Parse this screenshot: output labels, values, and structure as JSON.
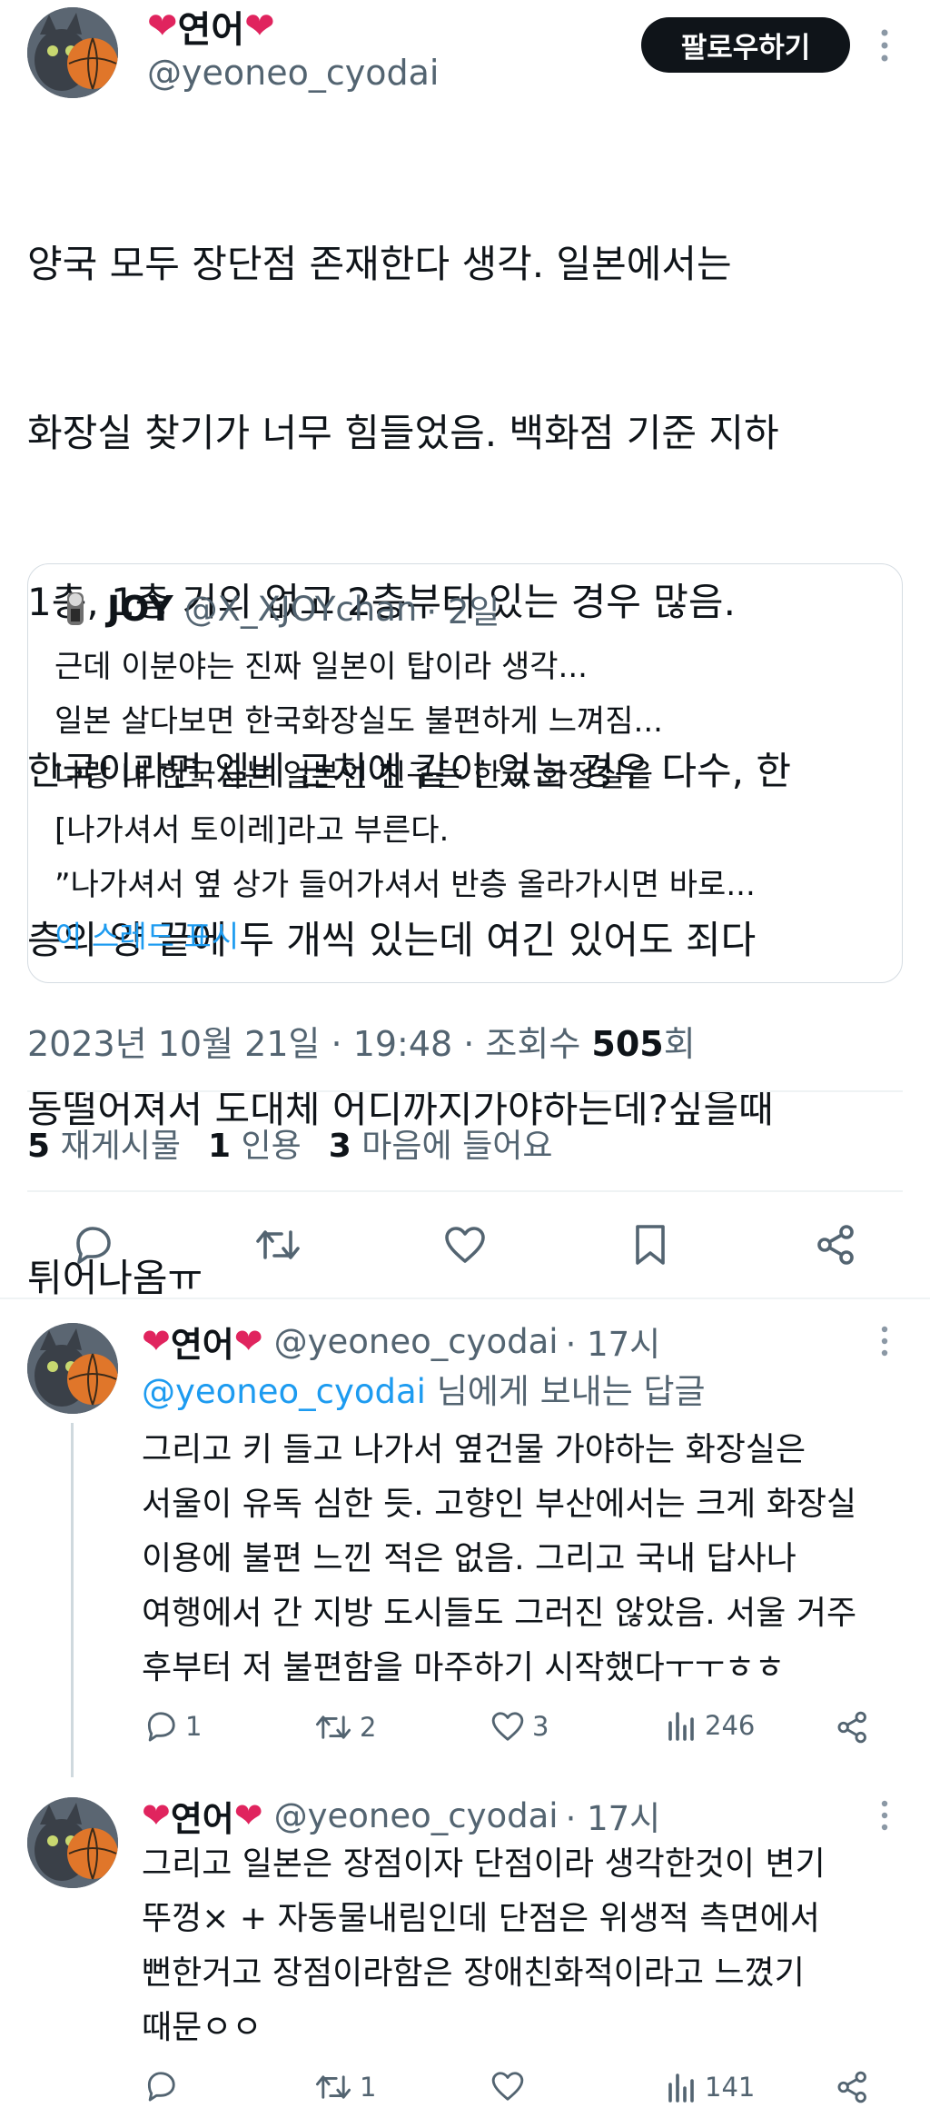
{
  "tweet": {
    "name": "연어",
    "handle": "@yeoneo_cyodai",
    "follow_label": "팔로우하기",
    "text_lines": [
      "양국 모두 장단점 존재한다 생각. 일본에서는",
      "화장실 찾기가 너무 힘들었음. 백화점 기준 지하",
      "1층, 1층 거의 없고 2층부터 있는 경우 많음.",
      "한국이라면 엘베 근처에 같이 있는 경우 다수, 한",
      "층의 양 끝에 두 개씩 있는데 여긴 있어도 죄다",
      "동떨어져서 도대체 어디까지가야하는데?싶을때",
      "튀어나옴ㅠ"
    ],
    "quote": {
      "name": "JOY",
      "handle": "@X_XJOYchan",
      "time": "· 2일",
      "lines": [
        "근데 이분야는 진짜 일본이 탑이라 생각...",
        "일본 살다보면 한국화장실도 불편하게 느껴짐...",
        "나랑 내 한국사는 일본인 친구는 한국 화장실을",
        "[나가셔서 토이레]라고 부른다.",
        "”나가셔서 옆 상가 들어가셔서 반층 올라가시면 바로..."
      ],
      "show_thread": "이 스레드 표시"
    },
    "meta": {
      "datetime": "2023년 10월 21일 · 19:48 · 조회수 ",
      "views": "505",
      "views_suffix": "회"
    },
    "stats": {
      "retweets_count": "5",
      "retweets_label": "재게시물",
      "quotes_count": "1",
      "quotes_label": "인용",
      "likes_count": "3",
      "likes_label": "마음에 들어요"
    }
  },
  "replies": [
    {
      "name": "연어",
      "handle": "@yeoneo_cyodai",
      "time": "· 17시",
      "reply_to_handle": "@yeoneo_cyodai",
      "reply_to_suffix": " 님에게 보내는 답글",
      "lines": [
        "그리고 키 들고 나가서 옆건물 가야하는 화장실은",
        "서울이 유독 심한 듯. 고향인 부산에서는 크게 화장실",
        "이용에 불편 느낀 적은 없음. 그리고 국내 답사나",
        "여행에서 간 지방 도시들도 그러진 않았음. 서울 거주",
        "후부터 저 불편함을 마주하기 시작했다ㅜㅜㅎㅎ"
      ],
      "reply_count": "1",
      "retweet_count": "2",
      "like_count": "3",
      "view_count": "246"
    },
    {
      "name": "연어",
      "handle": "@yeoneo_cyodai",
      "time": "· 17시",
      "lines": [
        "그리고 일본은 장점이자 단점이라 생각한것이 변기",
        "뚜껑× + 자동물내림인데 단점은 위생적 측면에서",
        "뻔한거고 장점이라함은 장애친화적이라고 느꼈기",
        "때문ㅇㅇ"
      ],
      "reply_count": "",
      "retweet_count": "1",
      "like_count": "",
      "view_count": "141"
    }
  ],
  "icons": {
    "heart_emoji": "❤",
    "more": "more-options-icon"
  },
  "colors": {
    "accent": "#1d9bf0",
    "text": "#0f1419",
    "secondary": "#536471"
  }
}
